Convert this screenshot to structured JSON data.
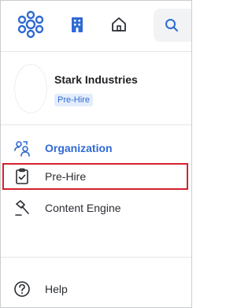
{
  "topbar": {
    "logo_icon": "connections-logo-icon",
    "building_icon": "building-icon",
    "home_icon": "home-icon",
    "search_icon": "search-icon",
    "accent": "#2f6ad3"
  },
  "company": {
    "name": "Stark Industries",
    "badge": "Pre-Hire"
  },
  "menu": {
    "items": [
      {
        "label": "Organization",
        "icon": "people-icon",
        "active": true
      },
      {
        "label": "Pre-Hire",
        "icon": "clipboard-check-icon",
        "highlighted": true
      },
      {
        "label": "Content Engine",
        "icon": "hammer-icon"
      }
    ],
    "help": {
      "label": "Help",
      "icon": "help-icon"
    }
  },
  "colors": {
    "active_text": "#2f6ad3",
    "highlight_border": "#d4212c",
    "badge_bg": "#e4edfb"
  }
}
